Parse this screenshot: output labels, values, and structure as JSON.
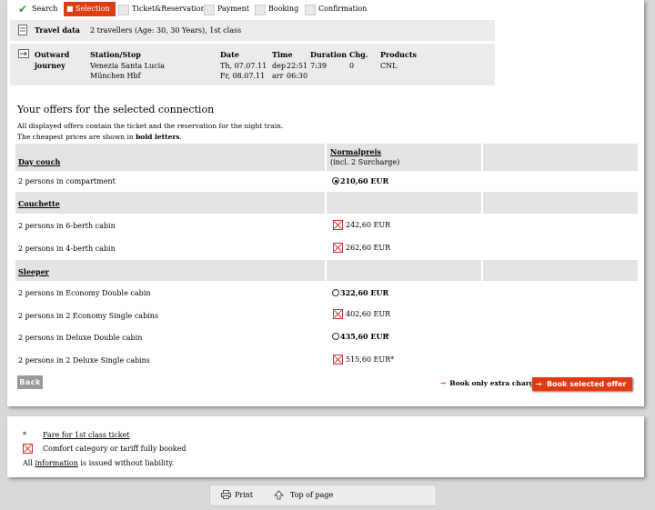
{
  "steps": [
    {
      "label": "Search",
      "state": "done"
    },
    {
      "label": "Selection",
      "state": "active"
    },
    {
      "label": "Ticket&Reservation",
      "state": "todo"
    },
    {
      "label": "Payment",
      "state": "todo"
    },
    {
      "label": "Booking",
      "state": "todo"
    },
    {
      "label": "Confirmation",
      "state": "todo"
    }
  ],
  "travel": {
    "label": "Travel data",
    "value": "2 travellers (Age: 30, 30 Years), 1st class"
  },
  "journey": {
    "label1": "Outward",
    "label2": "journey",
    "headers": {
      "station": "Station/Stop",
      "date": "Date",
      "time": "Time",
      "duration": "Duration",
      "changes": "Chg.",
      "products": "Products"
    },
    "from": "Venezia Santa Lucia",
    "to": "München Hbf",
    "date_from": "Th, 07.07.11",
    "date_to": "Fr, 08.07.11",
    "time_from_prefix": "dep",
    "time_from": "22:51",
    "time_to_prefix": "arr",
    "time_to": "06:30",
    "duration": "7:39",
    "changes": "0",
    "product": "CNL"
  },
  "offers": {
    "title": "Your offers for the selected connection",
    "note1": "All displayed offers contain the ticket and the reservation for the night train.",
    "note2_pre": "The cheapest prices are shown in ",
    "note2_bold": "bold letters",
    "note2_post": ".",
    "price_header": "Normalpreis",
    "price_sub": "(incl. 2 Surcharge)",
    "cat_day": "Day couch",
    "cat_couchette": "Couchette",
    "cat_sleeper": "Sleeper",
    "rows": {
      "r1": {
        "label": "2 persons in compartment",
        "price": "210,60 EUR"
      },
      "r2": {
        "label": "2 persons in 6-berth cabin",
        "price": "242,60 EUR"
      },
      "r3": {
        "label": "2 persons in 4-berth cabin",
        "price": "262,60 EUR"
      },
      "r4": {
        "label": "2 persons in Economy Double cabin",
        "price": "322,60 EUR"
      },
      "r5": {
        "label": "2 persons in 2 Economy Single cabins",
        "price": "402,60 EUR"
      },
      "r6": {
        "label": "2 persons in Deluxe Double cabin",
        "price": "435,60 EUR",
        "mark": "*"
      },
      "r7": {
        "label": "2 persons in 2 Deluxe Single cabins",
        "price": "515,60 EUR*"
      }
    }
  },
  "buttons": {
    "back": "Back",
    "extra": "Book only extra charge",
    "book": "Book selected offer"
  },
  "legend": {
    "star": "*",
    "star_text": "Fare for 1st class ticket",
    "x_text": "Comfort category or tariff fully booked",
    "info_pre": "All ",
    "info_link": "information",
    "info_post": " is issued without liability."
  },
  "footer": {
    "print": "Print",
    "top": "Top of page"
  },
  "colors": {
    "accent": "#e03c14",
    "row_grey": "#e3e3e3",
    "check": "#3a9a3a"
  }
}
